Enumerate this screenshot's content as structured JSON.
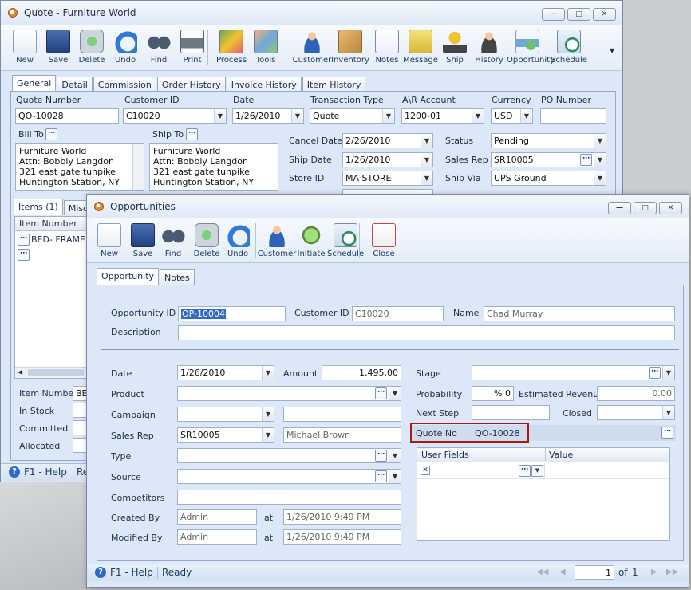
{
  "quote_window": {
    "title": "Quote - Furniture World",
    "toolbar": [
      {
        "label": "New",
        "icon": "new-icon"
      },
      {
        "label": "Save",
        "icon": "save-icon"
      },
      {
        "label": "Delete",
        "icon": "delete-icon"
      },
      {
        "label": "Undo",
        "icon": "undo-icon"
      },
      {
        "label": "Find",
        "icon": "find-icon"
      },
      {
        "label": "Print",
        "icon": "print-icon"
      },
      {
        "label": "Process",
        "icon": "process-icon"
      },
      {
        "label": "Tools",
        "icon": "tools-icon"
      },
      {
        "label": "Customer",
        "icon": "customer-icon"
      },
      {
        "label": "Inventory",
        "icon": "inventory-icon"
      },
      {
        "label": "Notes",
        "icon": "notes-icon"
      },
      {
        "label": "Message",
        "icon": "message-icon"
      },
      {
        "label": "Ship",
        "icon": "ship-icon"
      },
      {
        "label": "History",
        "icon": "history-icon"
      },
      {
        "label": "Opportunity",
        "icon": "opportunity-icon"
      },
      {
        "label": "Schedule",
        "icon": "schedule-icon"
      }
    ],
    "tabs": [
      "General",
      "Detail",
      "Commission",
      "Order History",
      "Invoice History",
      "Item History"
    ],
    "fields": {
      "quote_number_label": "Quote Number",
      "quote_number": "QO-10028",
      "customer_id_label": "Customer ID",
      "customer_id": "C10020",
      "date_label": "Date",
      "date": "1/26/2010",
      "transaction_type_label": "Transaction Type",
      "transaction_type": "Quote",
      "ar_account_label": "A\\R Account",
      "ar_account": "1200-01",
      "currency_label": "Currency",
      "currency": "USD",
      "po_number_label": "PO Number",
      "po_number": ""
    },
    "bill_to": {
      "label": "Bill To",
      "lines": [
        "Furniture World",
        "Attn: Bobbly Langdon",
        "321 east gate tunpike",
        "Huntington Station, NY"
      ]
    },
    "ship_to": {
      "label": "Ship To",
      "lines": [
        "Furniture World",
        "Attn: Bobbly Langdon",
        "321 east gate tunpike",
        "Huntington Station, NY"
      ]
    },
    "right_fields": {
      "cancel_date_label": "Cancel  Date",
      "cancel_date": "2/26/2010",
      "ship_date_label": "Ship Date",
      "ship_date": "1/26/2010",
      "store_id_label": "Store ID",
      "store_id": "MA STORE",
      "status_label": "Status",
      "status": "Pending",
      "sales_rep_label": "Sales Rep",
      "sales_rep": "SR10005",
      "ship_via_label": "Ship Via",
      "ship_via": "UPS Ground"
    },
    "items_tab": "Items (1)",
    "misc_tab": "Misc Ite",
    "items_grid_header": "Item Number",
    "items_rows": [
      "BED- FRAME",
      ""
    ],
    "bottom_labels": {
      "item_number": "Item Number",
      "item_number_value": "BED",
      "in_stock": "In Stock",
      "committed": "Committed",
      "allocated": "Allocated"
    },
    "status_help": "F1 - Help",
    "status_extra": "Re"
  },
  "opp_window": {
    "title": "Opportunities",
    "toolbar": [
      {
        "label": "New",
        "icon": "new-icon"
      },
      {
        "label": "Save",
        "icon": "save-icon"
      },
      {
        "label": "Find",
        "icon": "find-icon"
      },
      {
        "label": "Delete",
        "icon": "delete-icon"
      },
      {
        "label": "Undo",
        "icon": "undo-icon"
      },
      {
        "label": "Customer",
        "icon": "customer-icon"
      },
      {
        "label": "Initiate",
        "icon": "initiate-icon"
      },
      {
        "label": "Schedule",
        "icon": "schedule-icon"
      },
      {
        "label": "Close",
        "icon": "close-icon"
      }
    ],
    "tabs": [
      "Opportunity",
      "Notes"
    ],
    "header": {
      "opportunity_id_label": "Opportunity ID",
      "opportunity_id": "OP-10004",
      "customer_id_label": "Customer ID",
      "customer_id": "C10020",
      "name_label": "Name",
      "name": "Chad Murray",
      "description_label": "Description",
      "description": ""
    },
    "left": {
      "date_label": "Date",
      "date": "1/26/2010",
      "amount_label": "Amount",
      "amount": "1,495.00",
      "product_label": "Product",
      "product": "",
      "campaign_label": "Campaign",
      "campaign": "",
      "sales_rep_label": "Sales Rep",
      "sales_rep": "SR10005",
      "sales_rep_name": "Michael  Brown",
      "type_label": "Type",
      "type": "",
      "source_label": "Source",
      "source": "",
      "competitors_label": "Competitors",
      "competitors": "",
      "created_by_label": "Created By",
      "created_by": "Admin",
      "created_at_label": "at",
      "created_at": "1/26/2010 9:49 PM",
      "modified_by_label": "Modified By",
      "modified_by": "Admin",
      "modified_at_label": "at",
      "modified_at": "1/26/2010 9:49 PM"
    },
    "right": {
      "stage_label": "Stage",
      "stage": "",
      "probability_label": "Probability",
      "probability": "% 0",
      "estimated_revenue_label": "Estimated Revenue",
      "estimated_revenue": "0.00",
      "next_step_label": "Next Step",
      "next_step": "",
      "closed_label": "Closed",
      "closed": "",
      "quote_no_label": "Quote No",
      "quote_no": "QO-10028"
    },
    "user_fields": {
      "col1": "User Fields",
      "col2": "Value"
    },
    "status_help": "F1 - Help",
    "status_ready": "Ready",
    "pager": {
      "page": "1",
      "of_label": "of",
      "total": "1"
    }
  },
  "colors": {
    "highlight": "#a41a1a",
    "accent": "#2b6bc4"
  }
}
